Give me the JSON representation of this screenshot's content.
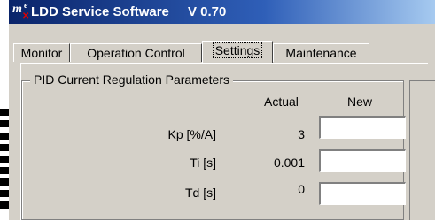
{
  "window": {
    "title": "LDD Service Software",
    "version": "V 0.70",
    "icon": "m-e-logo-icon"
  },
  "tabs": [
    {
      "label": "Monitor",
      "active": false
    },
    {
      "label": "Operation Control",
      "active": false
    },
    {
      "label": "Settings",
      "active": true
    },
    {
      "label": "Maintenance",
      "active": false
    }
  ],
  "pid_group": {
    "title": "PID Current Regulation Parameters",
    "col_actual": "Actual",
    "col_new": "New",
    "rows": [
      {
        "label": "Kp [%/A]",
        "actual": "3",
        "new": ""
      },
      {
        "label": "Ti [s]",
        "actual": "0.001",
        "new": ""
      },
      {
        "label": "Td [s]",
        "actual": "0",
        "new": ""
      }
    ]
  }
}
